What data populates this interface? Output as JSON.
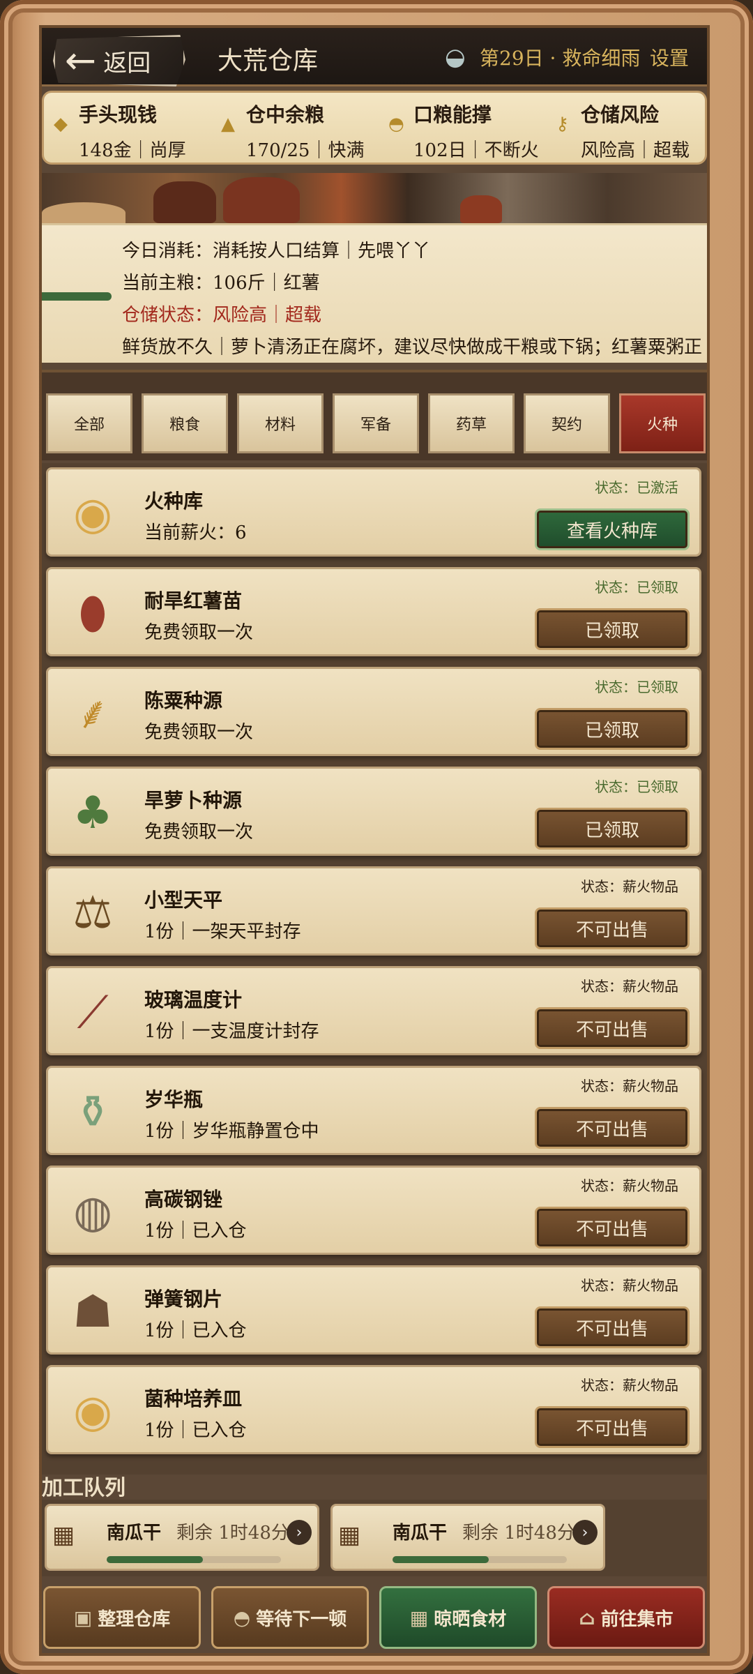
{
  "header": {
    "back_label": "返回",
    "title": "大荒仓库",
    "day": "第29日 · 救命细雨",
    "settings": "设置"
  },
  "stats": [
    {
      "name": "手头现钱",
      "value": "148金｜尚厚",
      "icon": "gold-ingot-icon"
    },
    {
      "name": "仓中余粮",
      "value": "170/25｜快满",
      "icon": "grain-pile-icon"
    },
    {
      "name": "口粮能撑",
      "value": "102日｜不断火",
      "icon": "food-bowl-icon"
    },
    {
      "name": "仓储风险",
      "value": "风险高｜超载",
      "icon": "key-icon"
    }
  ],
  "notice": {
    "line1": "今日消耗：消耗按人口结算｜先喂丫丫",
    "line2": "当前主粮：106斤｜红薯",
    "line3": "仓储状态：风险高｜超载",
    "line4": "鲜货放不久｜萝卜清汤正在腐坏，建议尽快做成干粮或下锅；红薯粟粥正"
  },
  "tabs": [
    "全部",
    "粮食",
    "材料",
    "军备",
    "药草",
    "契约",
    "火种"
  ],
  "active_tab": "火种",
  "items": [
    {
      "name": "火种库",
      "desc": "当前薪火：6",
      "status": "状态：已激活",
      "button": "查看火种库",
      "style": "green",
      "icon": "tea-bowl-icon"
    },
    {
      "name": "耐旱红薯苗",
      "desc": "免费领取一次",
      "status": "状态：已领取",
      "button": "已领取",
      "style": "brown",
      "icon": "sweet-potato-icon"
    },
    {
      "name": "陈粟种源",
      "desc": "免费领取一次",
      "status": "状态：已领取",
      "button": "已领取",
      "style": "brown",
      "icon": "millet-icon"
    },
    {
      "name": "旱萝卜种源",
      "desc": "免费领取一次",
      "status": "状态：已领取",
      "button": "已领取",
      "style": "brown",
      "icon": "radish-icon"
    },
    {
      "name": "小型天平",
      "desc": "1份｜一架天平封存",
      "status": "状态：薪火物品",
      "button": "不可出售",
      "style": "brown",
      "icon": "scale-icon"
    },
    {
      "name": "玻璃温度计",
      "desc": "1份｜一支温度计封存",
      "status": "状态：薪火物品",
      "button": "不可出售",
      "style": "brown",
      "icon": "thermometer-icon"
    },
    {
      "name": "岁华瓶",
      "desc": "1份｜岁华瓶静置仓中",
      "status": "状态：薪火物品",
      "button": "不可出售",
      "style": "brown",
      "icon": "vase-icon"
    },
    {
      "name": "高碳钢锉",
      "desc": "1份｜已入仓",
      "status": "状态：薪火物品",
      "button": "不可出售",
      "style": "brown",
      "icon": "dish-icon"
    },
    {
      "name": "弹簧钢片",
      "desc": "1份｜已入仓",
      "status": "状态：薪火物品",
      "button": "不可出售",
      "style": "brown",
      "icon": "sack-icon"
    },
    {
      "name": "菌种培养皿",
      "desc": "1份｜已入仓",
      "status": "状态：薪火物品",
      "button": "不可出售",
      "style": "brown",
      "icon": "petri-dish-icon"
    }
  ],
  "queue": {
    "label": "加工队列",
    "items": [
      {
        "name": "南瓜干",
        "time": "剩余 1时48分",
        "progress": 0.55
      },
      {
        "name": "南瓜干",
        "time": "剩余 1时48分",
        "progress": 0.55
      }
    ]
  },
  "bottom_buttons": [
    {
      "label": "整理仓库",
      "style": "brown",
      "icon": "storage-icon"
    },
    {
      "label": "等待下一顿",
      "style": "brown",
      "icon": "rice-bowl-icon"
    },
    {
      "label": "晾晒食材",
      "style": "green",
      "icon": "drying-rack-icon"
    },
    {
      "label": "前往集市",
      "style": "red",
      "icon": "market-icon"
    }
  ],
  "colors": {
    "active_tab": "#8e2a1e",
    "green_button": "#2f6a3c",
    "brown_button": "#6b4828",
    "risk_text": "#a2281c"
  }
}
